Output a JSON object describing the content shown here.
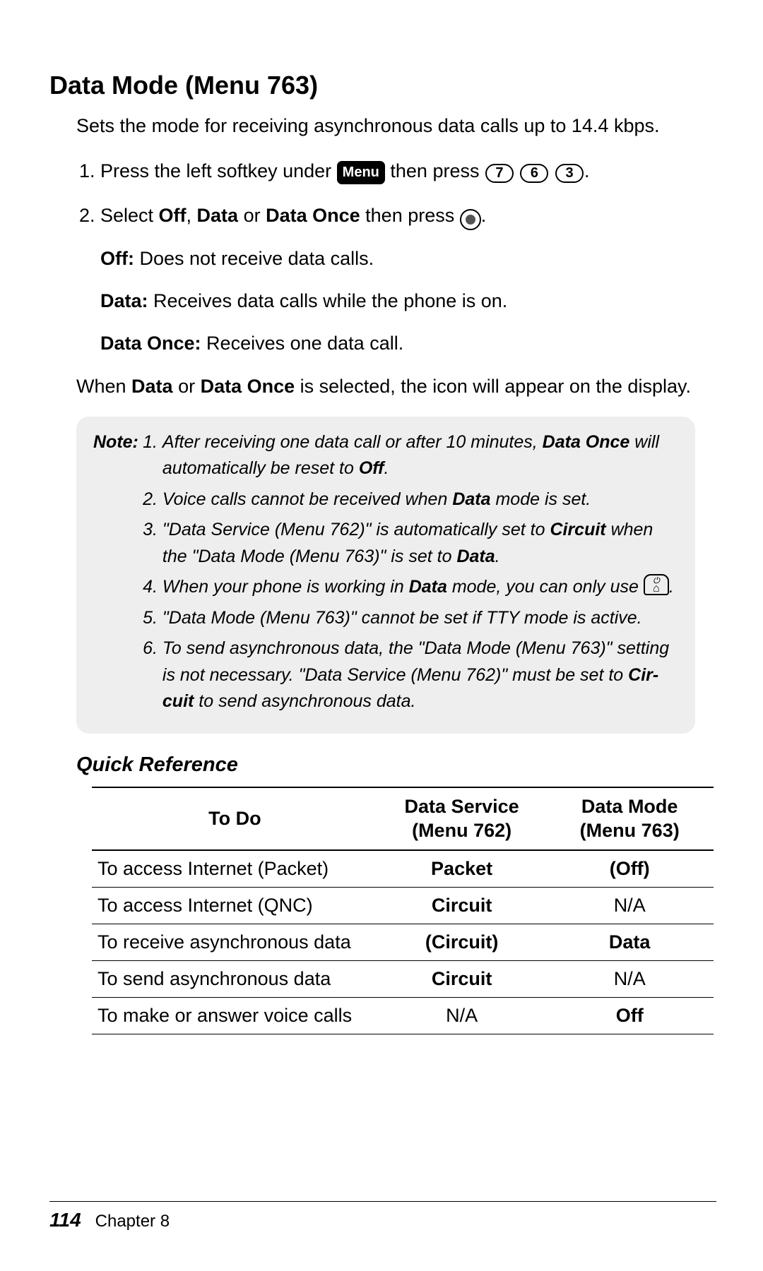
{
  "title": "Data Mode (Menu 763)",
  "intro": "Sets the mode for receiving asynchronous data calls up to 14.4 kbps.",
  "step1_a": "Press the left softkey under ",
  "menu_label": "Menu",
  "step1_b": " then press ",
  "keys": [
    "7",
    "6",
    "3"
  ],
  "period": ".",
  "step2_a": "Select ",
  "step2_b": "Off",
  "step2_c": ", ",
  "step2_d": "Data",
  "step2_e": " or ",
  "step2_f": "Data Once",
  "step2_g": " then press ",
  "off_label": "Off:",
  "off_text": " Does not receive data calls.",
  "data_label": "Data:",
  "data_text": " Receives data calls while the phone is on.",
  "once_label": "Data Once:",
  "once_text": " Receives one data call.",
  "sel_a": "When ",
  "sel_b": "Data",
  "sel_c": " or ",
  "sel_d": "Data Once",
  "sel_e": " is selected, the icon      will appear on the display.",
  "note_label": "Note:",
  "notes": {
    "n1a": "After receiving one data call or after 10 minutes, ",
    "n1b": "Data Once",
    "n1c": " will automatically be reset to ",
    "n1d": "Off",
    "n1e": ".",
    "n2a": "Voice calls cannot be received when ",
    "n2b": "Data",
    "n2c": " mode is set.",
    "n3a": "\"Data Service (Menu 762)\" is automatically set to ",
    "n3b": "Circuit",
    "n3c": " when the \"Data Mode (Menu 763)\" is set to ",
    "n3d": "Data",
    "n3e": ".",
    "n4a": "When your phone is working in ",
    "n4b": "Data",
    "n4c": " mode, you can only use ",
    "n4d": ".",
    "n5": "\"Data Mode (Menu 763)\" cannot be set if TTY mode is active.",
    "n6a": "To send asynchronous data, the \"Data Mode (Menu 763)\" setting is not necessary. \"Data Service (Menu 762)\" must be set to ",
    "n6b": "Cir­cuit",
    "n6c": " to send asynchronous data."
  },
  "qr_heading": "Quick Reference",
  "chart_data": {
    "type": "table",
    "headers": [
      "To Do",
      "Data Service (Menu 762)",
      "Data Mode (Menu 763)"
    ],
    "rows": [
      {
        "todo": "To access Internet (Packet)",
        "svc": "Packet",
        "svc_bold": true,
        "mode": "(Off)",
        "mode_bold": true
      },
      {
        "todo": "To access Internet (QNC)",
        "svc": "Circuit",
        "svc_bold": true,
        "mode": "N/A",
        "mode_bold": false
      },
      {
        "todo": "To receive asynchronous data",
        "svc": "(Circuit)",
        "svc_bold": true,
        "mode": "Data",
        "mode_bold": true
      },
      {
        "todo": "To send asynchronous data",
        "svc": "Circuit",
        "svc_bold": true,
        "mode": "N/A",
        "mode_bold": false
      },
      {
        "todo": "To make or answer voice calls",
        "svc": "N/A",
        "svc_bold": false,
        "mode": "Off",
        "mode_bold": true
      }
    ]
  },
  "footer": {
    "page": "114",
    "chapter": "Chapter 8"
  }
}
